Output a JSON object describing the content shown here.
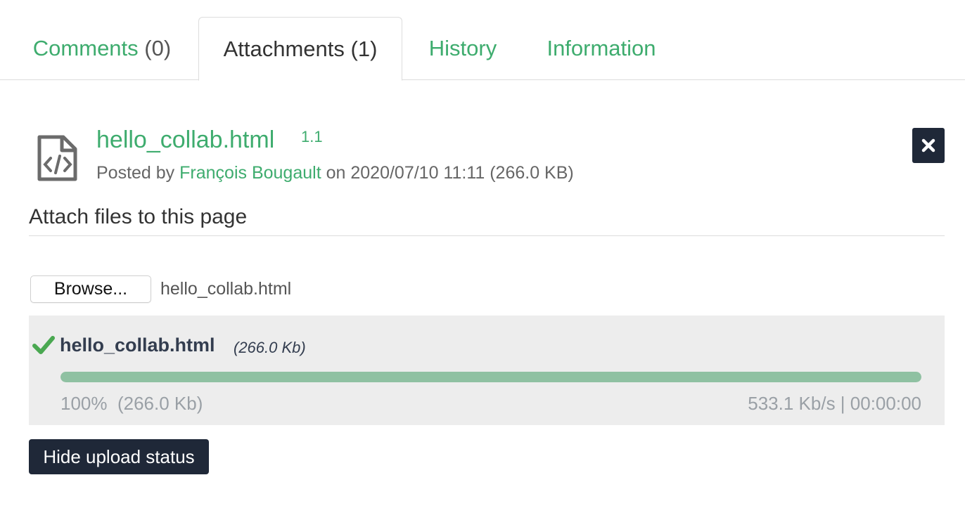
{
  "tabs": [
    {
      "label": "Comments",
      "count": "(0)",
      "active": false
    },
    {
      "label": "Attachments",
      "count": "(1)",
      "active": true
    },
    {
      "label": "History",
      "count": "",
      "active": false
    },
    {
      "label": "Information",
      "count": "",
      "active": false
    }
  ],
  "attachment": {
    "icon": "file-code-icon",
    "name": "hello_collab.html",
    "version": "1.1",
    "posted_by_prefix": "Posted by",
    "author": "François Bougault",
    "posted_suffix": "on 2020/07/10 11:11 (266.0 KB)",
    "delete_icon": "close-icon"
  },
  "upload_section": {
    "title": "Attach files to this page",
    "browse_label": "Browse...",
    "chosen_file": "hello_collab.html"
  },
  "upload_status": {
    "status_icon": "checkmark-icon",
    "file_name": "hello_collab.html",
    "file_size": "(266.0 Kb)",
    "progress_fraction": 1.0,
    "percent_text": "100%",
    "transferred_text": "(266.0 Kb)",
    "rate_text": "533.1 Kb/s | 00:00:00",
    "progress_color": "#8fc1a2",
    "hide_label": "Hide upload status"
  },
  "colors": {
    "accent": "#3eac6e",
    "dark_button": "#1f2838",
    "panel_bg": "#ededed"
  }
}
